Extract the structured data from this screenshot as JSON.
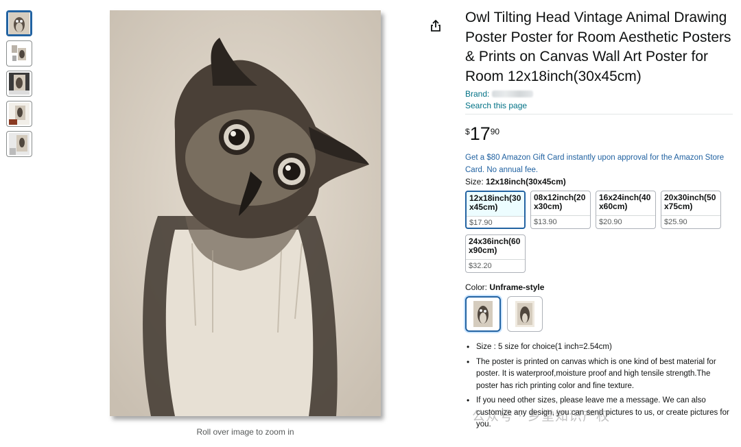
{
  "thumbnails": [
    {
      "name": "thumb-1",
      "active": true
    },
    {
      "name": "thumb-2",
      "active": false
    },
    {
      "name": "thumb-3",
      "active": false
    },
    {
      "name": "thumb-4",
      "active": false
    },
    {
      "name": "thumb-5",
      "active": false
    }
  ],
  "zoom_hint": "Roll over image to zoom in",
  "product": {
    "title": "Owl Tilting Head Vintage Animal Drawing Poster Poster for Room Aesthetic Posters & Prints on Canvas Wall Art Poster for Room 12x18inch(30x45cm)",
    "brand_label": "Brand:",
    "search_page": "Search this page",
    "price": {
      "symbol": "$",
      "whole": "17",
      "fraction": "90"
    },
    "promo": "Get a $80 Amazon Gift Card instantly upon approval for the Amazon Store Card. No annual fee."
  },
  "size": {
    "label": "Size:",
    "selected": "12x18inch(30x45cm)",
    "options": [
      {
        "name": "12x18inch(30x45cm)",
        "price": "$17.90"
      },
      {
        "name": "08x12inch(20x30cm)",
        "price": "$13.90"
      },
      {
        "name": "16x24inch(40x60cm)",
        "price": "$20.90"
      },
      {
        "name": "20x30inch(50x75cm)",
        "price": "$25.90"
      },
      {
        "name": "24x36inch(60x90cm)",
        "price": "$32.20"
      }
    ]
  },
  "color": {
    "label": "Color:",
    "selected": "Unframe-style"
  },
  "bullets": [
    "Size : 5 size for choice(1 inch=2.54cm)",
    "The poster is printed on canvas which is one kind of best material for poster. It is waterproof,moisture proof and high tensile strength.The poster has rich printing color and fine texture.",
    "If you need other sizes, please leave me a message. We can also customize any design, you can send pictures to us, or create pictures for you."
  ],
  "watermark": "公众号 · 乡堂知识产权",
  "colors": {
    "link": "#007185",
    "promo": "#2162a1",
    "selected_border": "#2162a1",
    "text": "#0f1111"
  }
}
